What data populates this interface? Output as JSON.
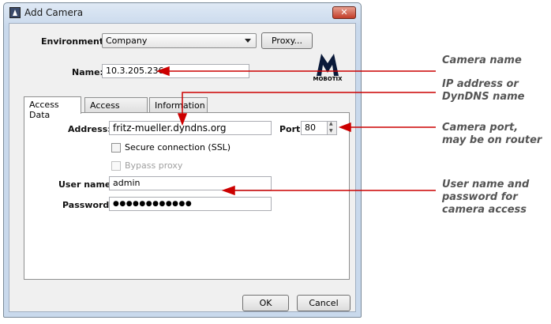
{
  "window": {
    "title": "Add Camera",
    "close_glyph": "✕"
  },
  "environment": {
    "label": "Environment:",
    "value": "Company",
    "proxy_button": "Proxy..."
  },
  "name": {
    "label": "Name:",
    "value": "10.3.205.236"
  },
  "logo": {
    "text": "MOBOTIX"
  },
  "tabs": [
    {
      "label": "Access Data",
      "active": true
    },
    {
      "label": "Access Mode",
      "active": false
    },
    {
      "label": "Information",
      "active": false
    }
  ],
  "access": {
    "address_label": "Address:",
    "address_value": "fritz-mueller.dyndns.org",
    "port_label": "Port:",
    "port_value": "80",
    "ssl_label": "Secure connection (SSL)",
    "bypass_label": "Bypass proxy",
    "username_label": "User name:",
    "username_value": "admin",
    "password_label": "Password:",
    "password_value": "●●●●●●●●●●●●"
  },
  "buttons": {
    "ok": "OK",
    "cancel": "Cancel"
  },
  "callouts": {
    "camera_name": "Camera name",
    "ip_line1": "IP address or",
    "ip_line2": "DynDNS name",
    "port_line1": "Camera port,",
    "port_line2": "may be on router",
    "user_line1": "User name and",
    "user_line2": "password for",
    "user_line3": "camera access"
  },
  "colors": {
    "arrow": "#cc0000",
    "callout_text": "#555555",
    "close_button": "#c23c28"
  }
}
